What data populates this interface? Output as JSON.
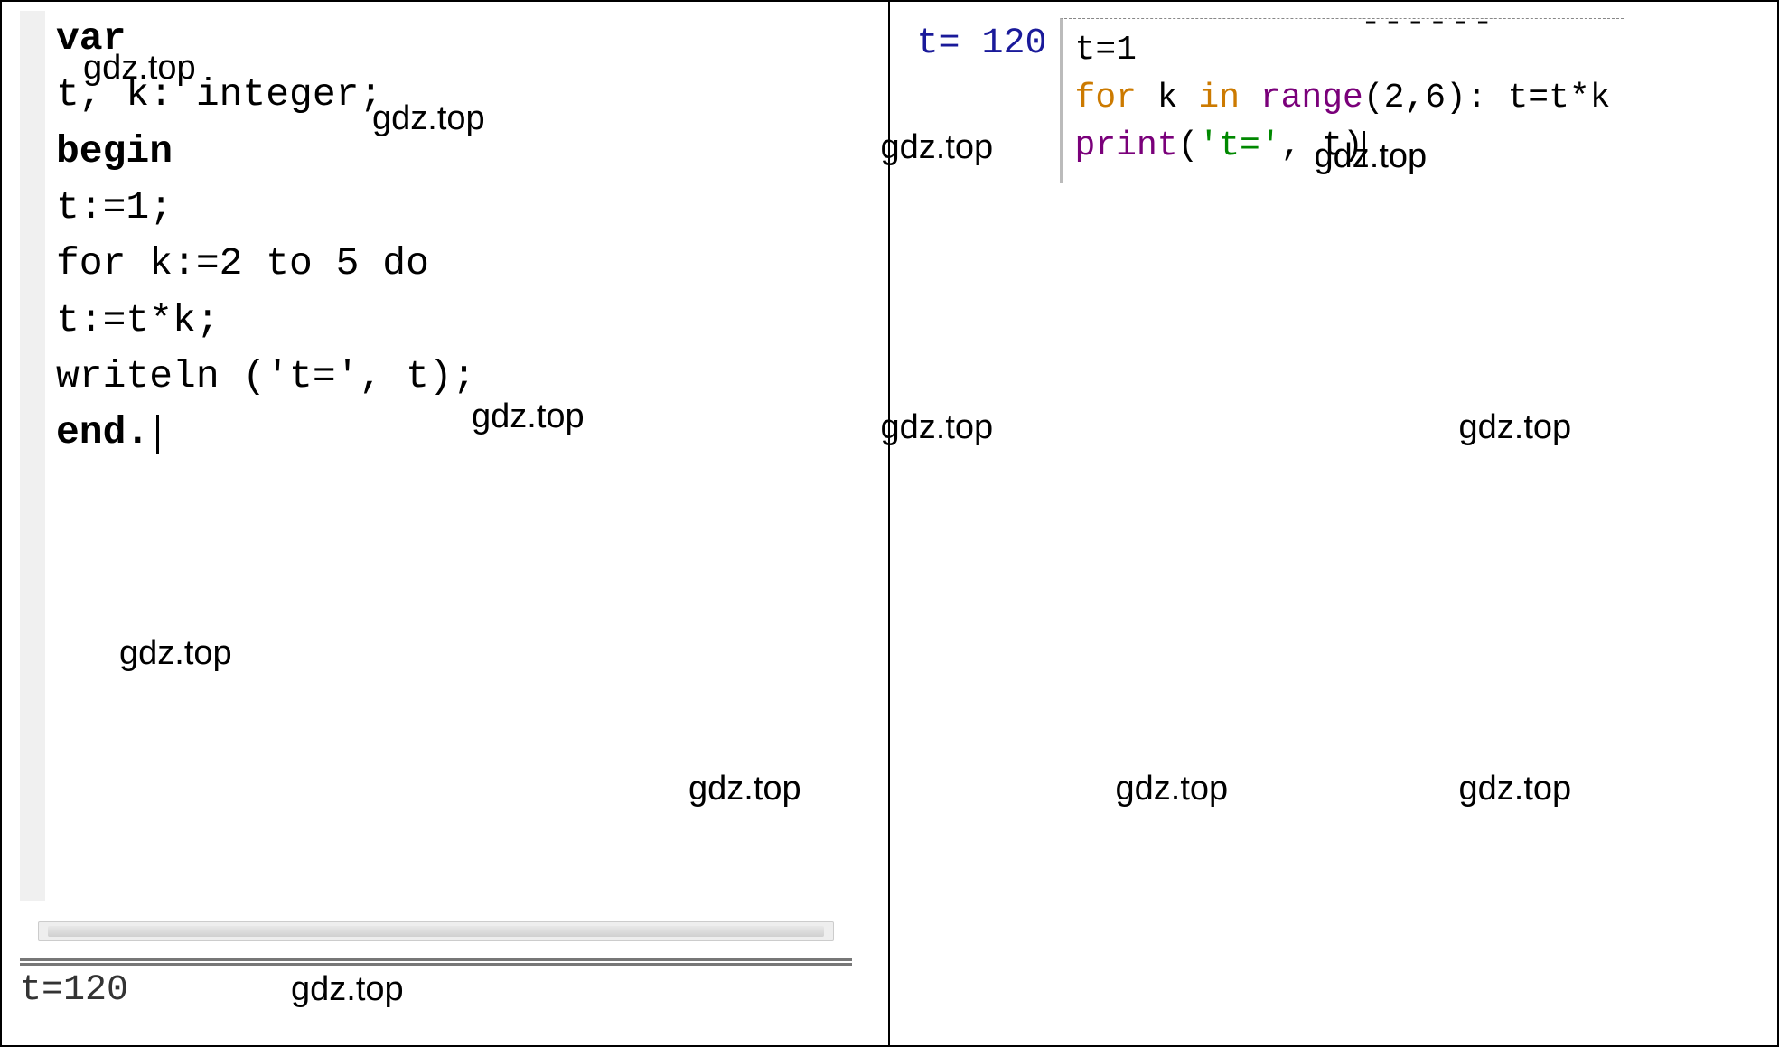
{
  "watermark": "gdz.top",
  "left": {
    "code": {
      "l1": "var",
      "l2": "t, k: integer;",
      "l3": "begin",
      "l4": "t:=1;",
      "l5": "for k:=2 to 5 do",
      "l6": "t:=t*k;",
      "l7": "writeln ('t=', t);",
      "l8": "end."
    },
    "output": "t=120"
  },
  "right": {
    "output_label": "t=",
    "output_value": "120",
    "dashes": "------",
    "code": {
      "l1_a": "t=",
      "l1_b": "1",
      "l2_for": "for",
      "l2_k": " k ",
      "l2_in": "in",
      "l2_sp": " ",
      "l2_range": "range",
      "l2_args": "(2,6)",
      "l2_tail": ": t=t*k",
      "l3_print": "print",
      "l3_open": "(",
      "l3_str": "'t='",
      "l3_rest": ", t)"
    }
  }
}
